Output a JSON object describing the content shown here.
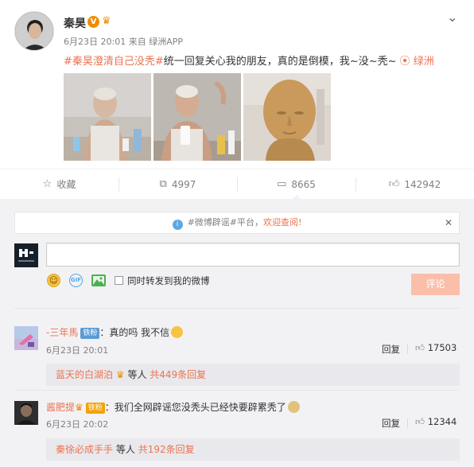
{
  "post": {
    "author": "秦昊",
    "verified_badge": "V",
    "date": "6月23日 20:01",
    "source": "来自 绿洲APP",
    "hashtag": "#秦昊澄清自己没秃#",
    "text": "统一回复关心我的朋友，真的是倒模，我~没~秃~",
    "location": "绿洲"
  },
  "actions": {
    "favorite": "收藏",
    "repost_count": "4997",
    "comment_count": "8665",
    "like_count": "142942"
  },
  "notice": {
    "text": "#微博辟谣#平台，",
    "link": "欢迎查阅!"
  },
  "composer": {
    "input_placeholder": "",
    "also_repost": "同时转发到我的微博",
    "submit": "评论"
  },
  "comments": [
    {
      "author": "-三年馬",
      "badge": "铁粉",
      "text": "：真的吗 我不信",
      "time": "6月23日 20:01",
      "reply_label": "回复",
      "likes": "17503",
      "sub_author": "蓝天的白湖泊",
      "sub_mid": "等人",
      "sub_count": "共449条回复"
    },
    {
      "author": "酱肥提",
      "badge": "铁粉",
      "text": "：我们全网辟谣您没秃头已经快要辟累秃了",
      "time": "6月23日 20:02",
      "reply_label": "回复",
      "likes": "12344",
      "sub_author": "秦徐必成手手",
      "sub_mid": "等人",
      "sub_count": "共192条回复"
    }
  ],
  "colors": {
    "accent": "#eb7350",
    "muted": "#808080",
    "panel": "#f2f2f5"
  }
}
